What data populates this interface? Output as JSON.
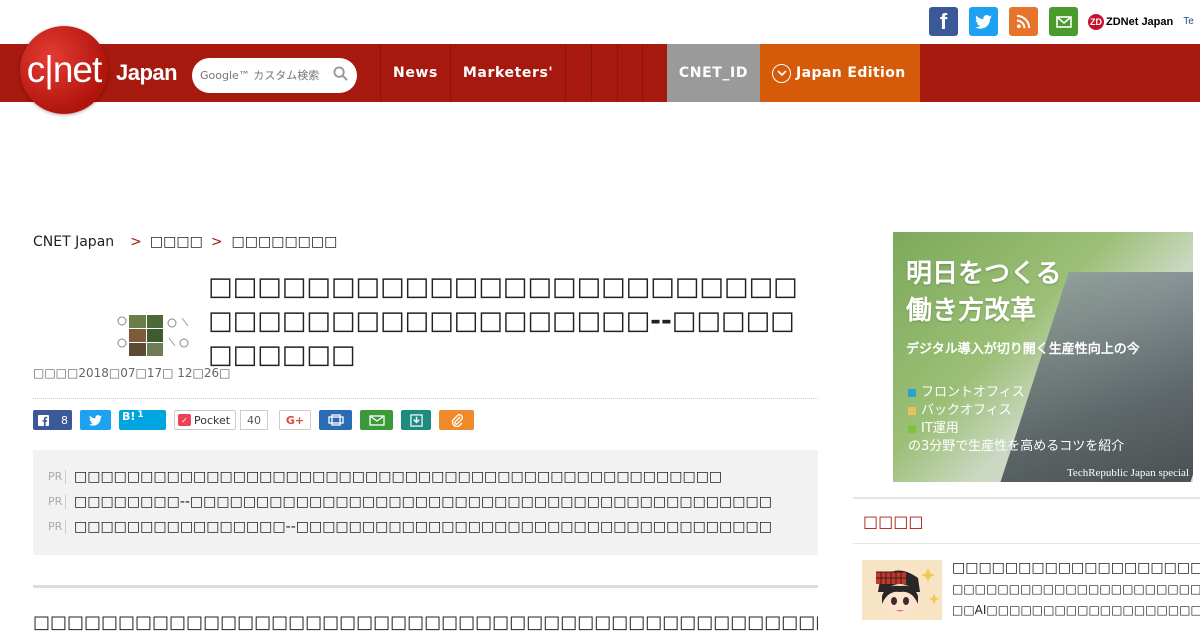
{
  "topbar": {
    "icons": [
      "facebook-icon",
      "twitter-icon",
      "rss-icon",
      "mail-icon"
    ],
    "zdnet_label": "ZDNet Japan",
    "zdnet_badge": "ZD",
    "techrepublic_label": "Te"
  },
  "nav": {
    "logo_text": "c|net",
    "logo_sub": "Japan",
    "search_placeholder": "Google™ カスタム検索",
    "items": [
      "News",
      "Marketers'"
    ],
    "cnet_id": "CNET_ID",
    "edition": "Japan Edition"
  },
  "breadcrumb": {
    "home": "CNET Japan",
    "sep": ">",
    "level2": "□□□□",
    "level3": "□□□□□□□□"
  },
  "article": {
    "title": "□□□□□□□□□□□□□□□□□□□□□□□□□□□□□□□□□□□□□□□□□□--□□□□□□□□□□□",
    "dateline": "□□□□2018□07□17□ 12□26□",
    "body_start": "□□□□□□□□□□□□□□□□□□□□□□□□□□□□□□□□□□□□□□□□□□□□□□□□□□□□□□□□□□□□□□□□□□□□□□□□□□□□□□□□□□□□□□"
  },
  "share": {
    "fb_count": "8",
    "hatena_label": "B!",
    "hatena_count": "1",
    "pocket_label": "Pocket",
    "pocket_count": "40",
    "gplus_label": "G+"
  },
  "pr": {
    "tag": "PR",
    "lines": [
      "□□□□□□□□□□□□□□□□□□□□□□□□□□□□□□□□□□□□□□□□□□□□□□□□□",
      "□□□□□□□□--□□□□□□□□□□□□□□□□□□□□□□□□□□□□□□□□□□□□□□□□□□□□",
      "□□□□□□□□□□□□□□□□--□□□□□□□□□□□□□□□□□□□□□□□□□□□□□□□□□□□□"
    ]
  },
  "ad": {
    "title_line1": "明日をつくる",
    "title_line2": "働き方改革",
    "subtitle": "デジタル導入が切り開く生産性向上の今",
    "items": [
      "フロントオフィス",
      "バックオフィス",
      "IT運用"
    ],
    "item_colors": [
      "#29a3d4",
      "#e8c25a",
      "#7fc241"
    ],
    "tail": "の3分野で生産性を高めるコツを紹介",
    "footer": "TechRepublic Japan special"
  },
  "sidebar": {
    "heading": "□□□□",
    "item_title": "□□□□□□□□□□□□□□□□□□□□",
    "item_text1": "□□□□□□□□□□□□□□□□□□□□□□",
    "item_text2": "□□AI□□□□□□□□□□□□□□□□□□□□"
  },
  "colors": {
    "nav_red": "#a7190f",
    "cnet_id_gray": "#9a9a9a",
    "edition_orange": "#d65b08"
  }
}
